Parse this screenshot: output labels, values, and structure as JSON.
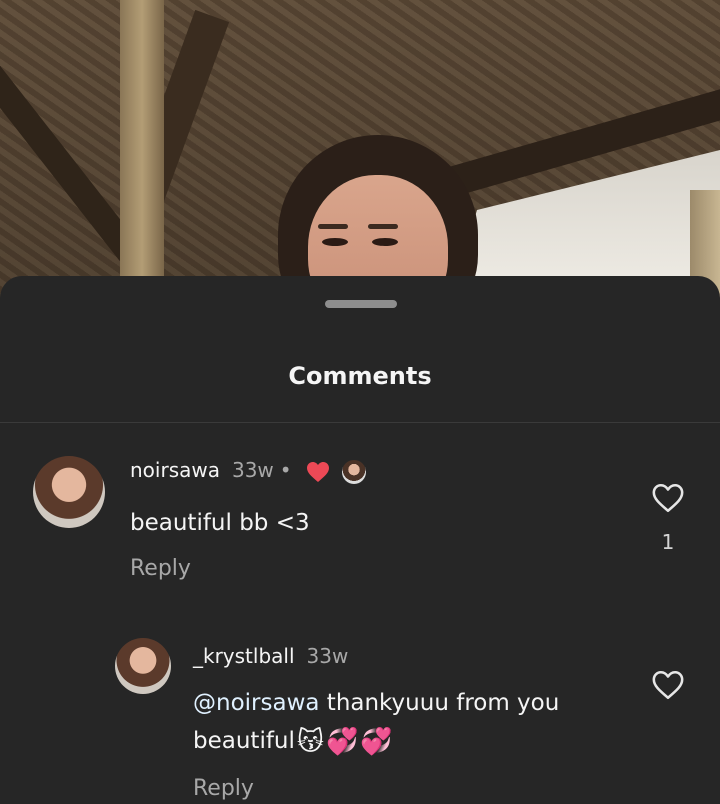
{
  "sheet": {
    "title": "Comments"
  },
  "comments": [
    {
      "username": "noirsawa",
      "time": "33w",
      "separator": "•",
      "text": "beautiful bb <3",
      "reply_label": "Reply",
      "like_count": "1",
      "liked_by_creator": true
    },
    {
      "username": "_krystlball",
      "time": "33w",
      "mention": "@noirsawa",
      "text_line1": " thankyuuu from you",
      "text_line2": "beautiful",
      "emojis": [
        "😽",
        "💞",
        "💞"
      ],
      "reply_label": "Reply"
    }
  ],
  "colors": {
    "sheet_bg": "#262626",
    "heart_red": "#ed4956",
    "secondary_text": "#a8a8a8",
    "mention": "#e0f1ff"
  },
  "icons": {
    "like": "heart-outline-icon",
    "creator_like": "heart-filled-icon"
  }
}
